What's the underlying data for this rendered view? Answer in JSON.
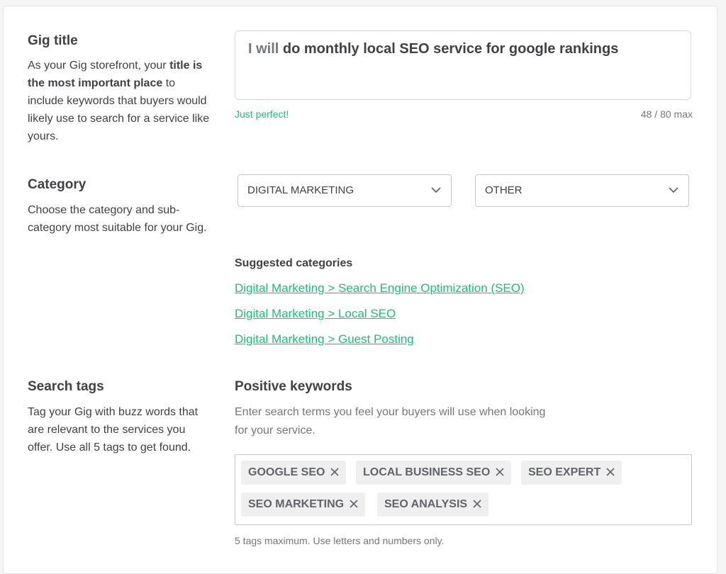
{
  "gig_title": {
    "heading": "Gig title",
    "desc_part1": "As your Gig storefront, your ",
    "desc_bold": "title is the most important place",
    "desc_part2": " to include keywords that buyers would likely use to search for a service like yours.",
    "prefix": "I will",
    "value": "do monthly local SEO service for google rankings",
    "status": "Just perfect!",
    "counter": "48 / 80 max"
  },
  "category": {
    "heading": "Category",
    "desc": "Choose the category and sub-category most suitable for your Gig.",
    "category_value": "DIGITAL MARKETING",
    "subcategory_value": "OTHER",
    "suggested_title": "Suggested categories",
    "suggestions": [
      "Digital Marketing > Search Engine Optimization (SEO)",
      "Digital Marketing > Local SEO",
      "Digital Marketing > Guest Posting"
    ]
  },
  "search_tags": {
    "heading": "Search tags",
    "desc": "Tag your Gig with buzz words that are relevant to the services you offer. Use all 5 tags to get found.",
    "keywords_title": "Positive keywords",
    "keywords_desc": "Enter search terms you feel your buyers will use when looking for your service.",
    "tags": [
      "GOOGLE SEO",
      "LOCAL BUSINESS SEO",
      "SEO EXPERT",
      "SEO MARKETING",
      "SEO ANALYSIS"
    ],
    "note": "5 tags maximum. Use letters and numbers only."
  },
  "colors": {
    "accent_green": "#1dbf73",
    "text_dark": "#404145",
    "text_muted": "#74767e"
  },
  "icons": {
    "dropdown": "chevron-down-icon",
    "tag_remove": "close-icon"
  }
}
